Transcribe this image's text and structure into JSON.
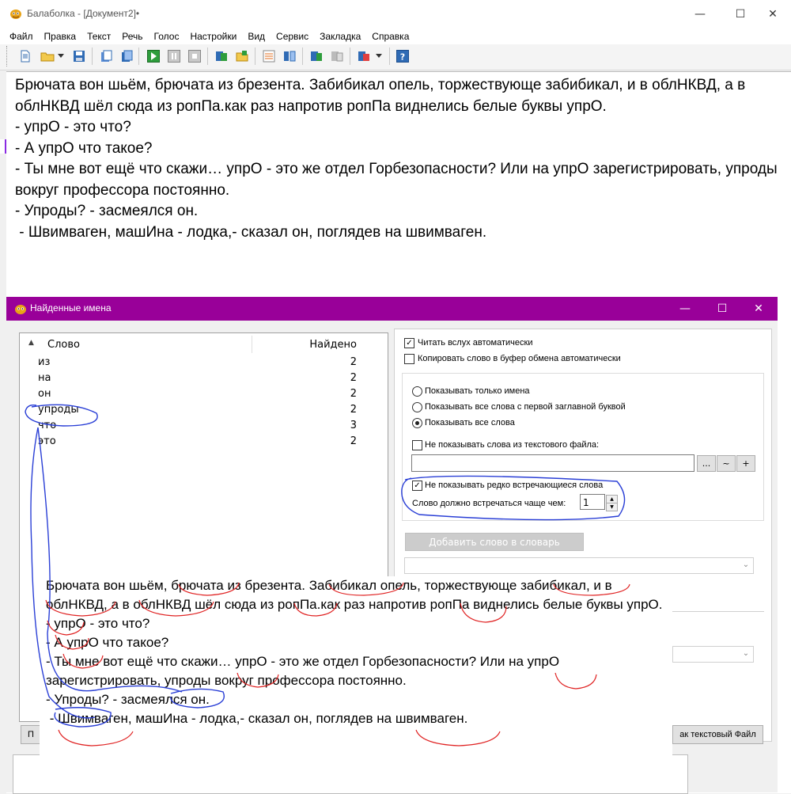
{
  "app": {
    "title": "Балаболка - [Документ2]•",
    "controls": {
      "minimize": "—",
      "maximize": "☐",
      "close": "✕"
    }
  },
  "menu": [
    "Файл",
    "Правка",
    "Текст",
    "Речь",
    "Голос",
    "Настройки",
    "Вид",
    "Сервис",
    "Закладка",
    "Справка"
  ],
  "toolbar": {
    "icons": [
      "new-document-icon",
      "open-folder-icon",
      "save-icon",
      "open-clipboard-icon",
      "save-clipboard-icon",
      "play-icon",
      "pause-icon",
      "stop-icon",
      "read-clipboard-icon",
      "read-file-icon",
      "options-icon",
      "voices-icon",
      "spell-check-icon",
      "dictionary-icon",
      "convert-icon",
      "help-icon"
    ]
  },
  "document": {
    "text": "Брючата вон шьём, брючата из брезента. Забибикал опель, торжествующе забибикал, и в облНКВД, а в облНКВД шёл сюда из ропПа.как раз напротив ропПа виднелись белые буквы упрО.\n- упрО - это что?\n- А упрО что такое?\n- Ты мне вот ещё что скажи… упрО - это же отдел Горбезопасности? Или на упрО зарегистрировать, упроды вокруг профессора постоянно.\n- Упроды? - засмеялся он.\n - Швимваген, машИна - лодка,- сказал он, поглядев на швимваген."
  },
  "dialog": {
    "title": "Найденные имена",
    "controls": {
      "minimize": "—",
      "maximize": "☐",
      "close": "✕"
    },
    "list": {
      "sort_indicator": "▲",
      "col_word": "Слово",
      "col_count": "Найдено",
      "rows": [
        {
          "word": "из",
          "count": "2"
        },
        {
          "word": "на",
          "count": "2"
        },
        {
          "word": "он",
          "count": "2"
        },
        {
          "word": "упроды",
          "count": "2"
        },
        {
          "word": "что",
          "count": "3"
        },
        {
          "word": "это",
          "count": "2"
        }
      ]
    },
    "options": {
      "read_aloud": {
        "label": "Читать вслух автоматически",
        "checked": true
      },
      "copy_clipboard": {
        "label": "Копировать слово в буфер обмена автоматически",
        "checked": false
      },
      "radio": [
        {
          "label": "Показывать только имена",
          "selected": false
        },
        {
          "label": "Показывать все слова с первой заглавной буквой",
          "selected": false
        },
        {
          "label": "Показывать все слова",
          "selected": true
        }
      ],
      "exclude_file": {
        "label": "Не показывать слова из текстового файла:",
        "checked": false,
        "value": ""
      },
      "file_buttons": [
        "...",
        "~",
        "+"
      ],
      "hide_rare": {
        "label": "Не показывать редко встречающиеся слова",
        "checked": true
      },
      "min_count_label": "Слово должно встречаться чаще чем:",
      "min_count_value": "1",
      "add_word_button": "Добавить слово в словарь"
    },
    "bottom_buttons": {
      "left": "П",
      "right": "ак текстовый Файл"
    }
  },
  "overlay": {
    "text": "Брючата вон шьём, брючата из брезента. Забибикал опель, торжествующе забибикал, и в облНКВД, а в облНКВД шёл сюда из ропПа.как раз напротив ропПа виднелись белые буквы упрО.\n- упрО - это что?\n- А упрО что такое?\n- Ты мне вот ещё что скажи… упрО - это же отдел Горбезопасности? Или на упрО зарегистрировать, упроды вокруг профессора постоянно.\n- Упроды? - засмеялся он.\n - Швимваген, машИна - лодка,- сказал он, поглядев на швимваген."
  }
}
